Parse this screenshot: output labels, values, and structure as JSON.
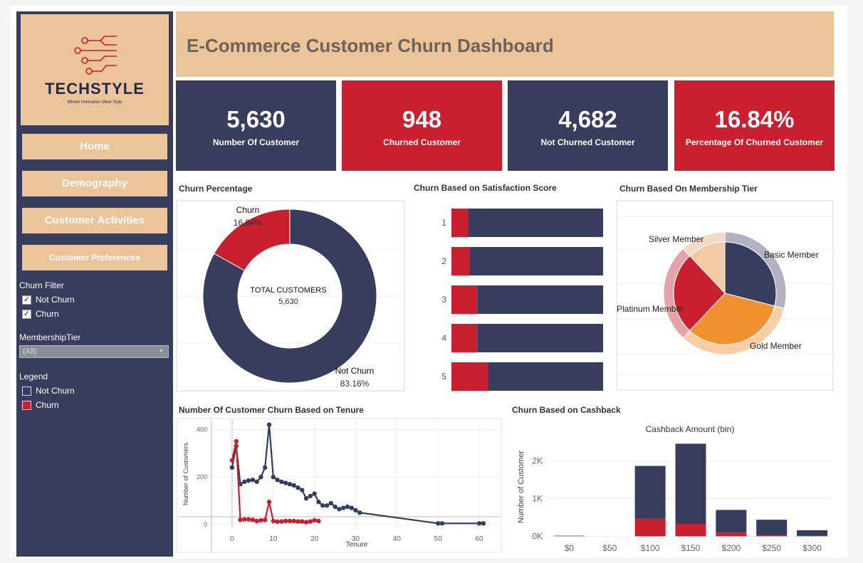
{
  "header": {
    "title": "E-Commerce Customer Churn Dashboard"
  },
  "logo": {
    "name": "TECHSTYLE",
    "tagline": "Where Innovation Meet Style"
  },
  "nav": [
    {
      "label": "Home"
    },
    {
      "label": "Demography"
    },
    {
      "label": "Customer Activities"
    },
    {
      "label": "Customer Preferences"
    }
  ],
  "filters": {
    "churn_filter_label": "Churn Filter",
    "options": [
      {
        "label": "Not Churn",
        "checked": true
      },
      {
        "label": "Churn",
        "checked": true
      }
    ],
    "membership_label": "MembershipTier",
    "membership_value": "(All)"
  },
  "legend": {
    "title": "Legend",
    "items": [
      {
        "label": "Not Churn",
        "color": "#373d5c"
      },
      {
        "label": "Churn",
        "color": "#c91f2e"
      }
    ]
  },
  "kpis": [
    {
      "value": "5,630",
      "label": "Number Of Customer",
      "color": "#373d5c"
    },
    {
      "value": "948",
      "label": "Churned Customer",
      "color": "#c91f2e"
    },
    {
      "value": "4,682",
      "label": "Not Churned Customer",
      "color": "#373d5c"
    },
    {
      "value": "16.84%",
      "label": "Percentage Of Churned Customer",
      "color": "#c91f2e"
    }
  ],
  "colors": {
    "navy": "#373d5c",
    "red": "#c91f2e",
    "beige": "#ecc49a",
    "orange": "#f0902f",
    "gray": "#b1b3c3"
  },
  "panels": {
    "churn_pct": "Churn Percentage",
    "satisfaction": "Churn Based on Satisfaction Score",
    "membership": "Churn Based On Membership Tier",
    "tenure": "Number Of Customer Churn Based on Tenure",
    "cashback": "Churn Based on Cashback"
  },
  "chart_data": [
    {
      "type": "pie",
      "name": "churn_percentage",
      "center_label": "TOTAL CUSTOMERS",
      "center_value": "5,630",
      "slices": [
        {
          "label": "Churn",
          "pct_label": "16.84%",
          "value": 16.84,
          "color": "#c91f2e"
        },
        {
          "label": "Not Churn",
          "pct_label": "83.16%",
          "value": 83.16,
          "color": "#373d5c"
        }
      ]
    },
    {
      "type": "bar",
      "name": "satisfaction",
      "orientation": "horizontal",
      "stacked": true,
      "categories": [
        "1",
        "2",
        "3",
        "4",
        "5"
      ],
      "series": [
        {
          "name": "Churn",
          "values": [
            11,
            12,
            17,
            17,
            24
          ]
        },
        {
          "name": "Not Churn",
          "values": [
            89,
            88,
            83,
            83,
            76
          ]
        }
      ]
    },
    {
      "type": "pie",
      "name": "membership",
      "slices": [
        {
          "label": "Basic Member",
          "value": 29,
          "inner_color": "#373d5c",
          "outer_color": "#b1b3c3"
        },
        {
          "label": "Gold Member",
          "value": 33,
          "inner_color": "#f0902f",
          "outer_color": "#f6cfa6"
        },
        {
          "label": "Platinum Member",
          "value": 26,
          "inner_color": "#c91f2e",
          "outer_color": "#e3a3a8"
        },
        {
          "label": "Silver Member",
          "value": 12,
          "inner_color": "#f2cba5",
          "outer_color": "#f1dcc6"
        }
      ]
    },
    {
      "type": "line",
      "name": "tenure",
      "xlabel": "Tenure",
      "ylabel": "Number of Customers",
      "xlim": [
        -5,
        65
      ],
      "ylim": [
        -15,
        440
      ],
      "xticks": [
        0,
        10,
        20,
        30,
        40,
        50,
        60
      ],
      "yticks": [
        0,
        200,
        400
      ],
      "series": [
        {
          "name": "Not Churn",
          "color": "#373d5c",
          "x": [
            0,
            1,
            2,
            3,
            4,
            5,
            6,
            7,
            8,
            9,
            10,
            11,
            12,
            13,
            14,
            15,
            16,
            17,
            18,
            19,
            20,
            21,
            22,
            23,
            24,
            25,
            26,
            27,
            28,
            29,
            30,
            31,
            50,
            51,
            60,
            61
          ],
          "y": [
            240,
            330,
            170,
            180,
            185,
            188,
            180,
            200,
            240,
            420,
            200,
            188,
            180,
            175,
            170,
            165,
            155,
            145,
            110,
            120,
            130,
            95,
            80,
            80,
            90,
            75,
            65,
            70,
            75,
            70,
            60,
            50,
            5,
            5,
            5,
            5
          ]
        },
        {
          "name": "Churn",
          "color": "#c91f2e",
          "x": [
            0,
            1,
            2,
            3,
            4,
            5,
            6,
            7,
            8,
            9,
            10,
            11,
            12,
            13,
            14,
            15,
            16,
            17,
            18,
            19,
            20,
            21
          ],
          "y": [
            270,
            350,
            20,
            22,
            22,
            20,
            15,
            18,
            20,
            95,
            15,
            12,
            13,
            15,
            15,
            15,
            13,
            13,
            10,
            13,
            18,
            15
          ]
        }
      ]
    },
    {
      "type": "bar",
      "name": "cashback",
      "stacked": true,
      "title": "Cashback Amount (bin)",
      "ylabel": "Number of Customer",
      "categories": [
        "$0",
        "$50",
        "$100",
        "$150",
        "$200",
        "$250",
        "$300"
      ],
      "ylim": [
        -200,
        2600
      ],
      "yticks": [
        0,
        1000,
        2000
      ],
      "ytick_labels": [
        "0K",
        "1K",
        "2K"
      ],
      "series": [
        {
          "name": "Churn",
          "values": [
            5,
            0,
            470,
            330,
            100,
            25,
            10
          ]
        },
        {
          "name": "Not Churn",
          "values": [
            10,
            0,
            1400,
            2130,
            600,
            415,
            150
          ]
        }
      ]
    }
  ]
}
